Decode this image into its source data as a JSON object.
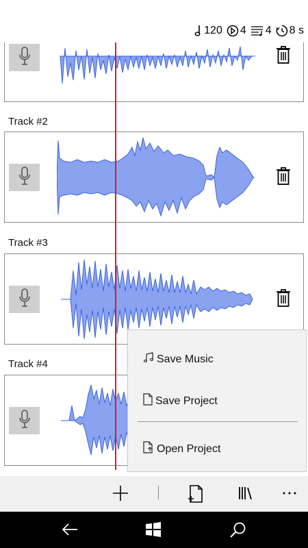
{
  "status_bar": {
    "tempo": "120",
    "beats_per_bar": "4",
    "bars": "4",
    "timer": "8 s"
  },
  "tracks": [
    {
      "label": "Track #2"
    },
    {
      "label": "Track #3"
    },
    {
      "label": "Track #4"
    }
  ],
  "menu": {
    "save_music": "Save Music",
    "save_project": "Save Project",
    "open_project": "Open Project"
  },
  "colors": {
    "waveform_fill": "#8aa2f0",
    "waveform_stroke": "#3b63d8",
    "playhead": "#e01b1b",
    "mic_button_bg": "#cfcfcf"
  },
  "icons": {
    "status": [
      "note-icon",
      "metronome-icon",
      "bars-icon",
      "timer-icon"
    ],
    "track": [
      "microphone-icon",
      "trash-icon"
    ],
    "app_bar": [
      "add-icon",
      "new-file-icon",
      "library-icon",
      "more-icon"
    ],
    "nav": [
      "back-icon",
      "windows-icon",
      "search-icon"
    ]
  }
}
